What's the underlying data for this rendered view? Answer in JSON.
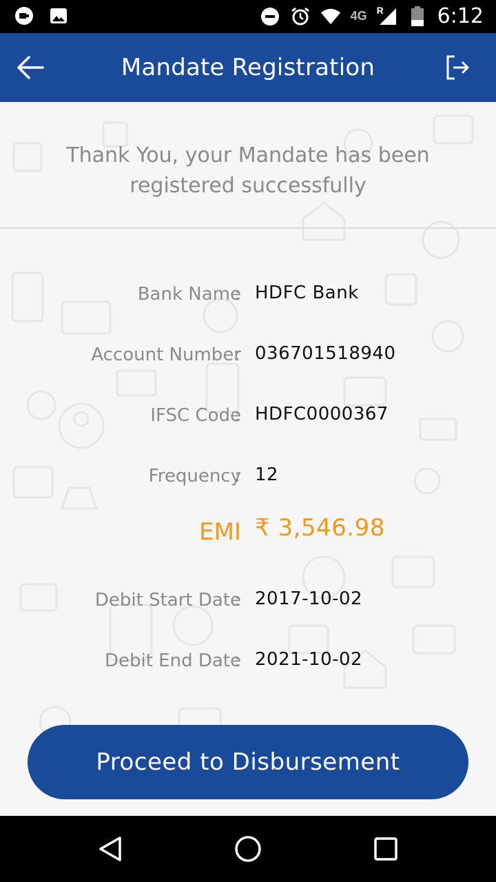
{
  "status_bar": {
    "network_label": "4G",
    "roaming_label": "R",
    "time": "6:12"
  },
  "app_bar": {
    "title": "Mandate Registration",
    "back_icon": "arrow-left-icon",
    "exit_icon": "logout-icon"
  },
  "message": {
    "line1": "Thank You, your Mandate has been",
    "line2": "registered successfully"
  },
  "details": [
    {
      "label": "Bank Name",
      "value": "HDFC Bank"
    },
    {
      "label": "Account Number",
      "value": "036701518940"
    },
    {
      "label": "IFSC Code",
      "value": "HDFC0000367"
    },
    {
      "label": "Frequency",
      "value": "12"
    },
    {
      "label": "EMI",
      "value": "₹ 3,546.98"
    },
    {
      "label": "Debit Start Date",
      "value": "2017-10-02"
    },
    {
      "label": "Debit End Date",
      "value": "2021-10-02"
    }
  ],
  "separator": ":",
  "cta": {
    "label": "Proceed to Disbursement"
  },
  "colors": {
    "primary": "#1a4b9b",
    "accent": "#f0981f",
    "label_gray": "#8a8a8a"
  }
}
